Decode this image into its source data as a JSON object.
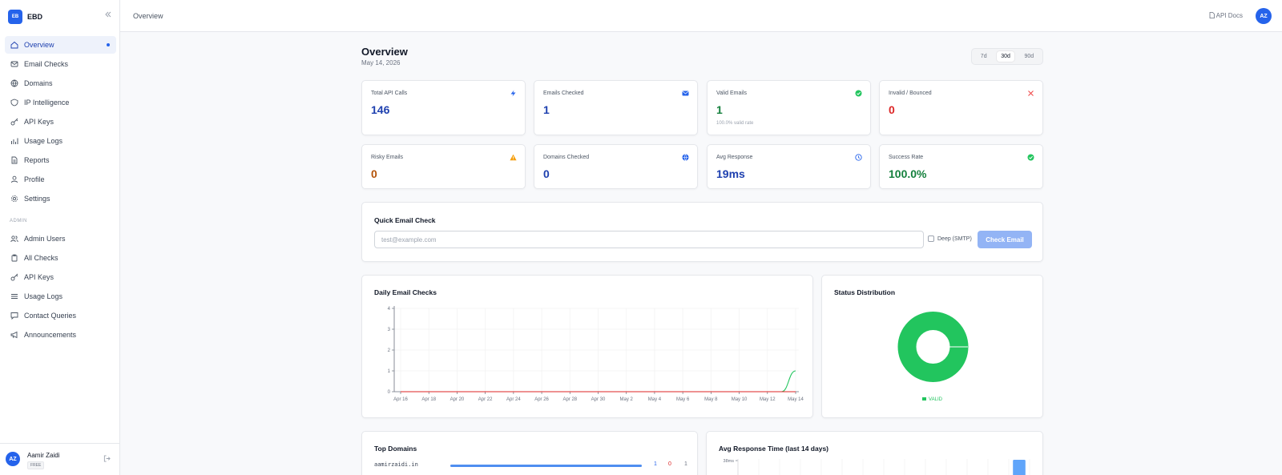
{
  "brand": {
    "logo": "EB",
    "name": "EBD"
  },
  "sidebar": {
    "items": [
      {
        "label": "Overview",
        "icon": "home-icon",
        "active": true
      },
      {
        "label": "Email Checks",
        "icon": "mail-icon"
      },
      {
        "label": "Domains",
        "icon": "globe-icon"
      },
      {
        "label": "IP Intelligence",
        "icon": "shield-icon"
      },
      {
        "label": "API Keys",
        "icon": "key-icon"
      },
      {
        "label": "Usage Logs",
        "icon": "bar-chart-icon"
      },
      {
        "label": "Reports",
        "icon": "file-icon"
      },
      {
        "label": "Profile",
        "icon": "user-icon"
      },
      {
        "label": "Settings",
        "icon": "gear-icon"
      }
    ],
    "admin_label": "ADMIN",
    "admin_items": [
      {
        "label": "Admin Users",
        "icon": "users-icon"
      },
      {
        "label": "All Checks",
        "icon": "clipboard-icon"
      },
      {
        "label": "API Keys",
        "icon": "key-icon"
      },
      {
        "label": "Usage Logs",
        "icon": "list-icon"
      },
      {
        "label": "Contact Queries",
        "icon": "message-icon"
      },
      {
        "label": "Announcements",
        "icon": "megaphone-icon"
      }
    ],
    "user": {
      "initials": "AZ",
      "name": "Aamir Zaidi",
      "plan": "FREE"
    }
  },
  "topbar": {
    "breadcrumb": "Overview",
    "api_docs": "API Docs",
    "avatar": "AZ"
  },
  "header": {
    "title": "Overview",
    "date": "May 14, 2026"
  },
  "range": {
    "options": [
      "7d",
      "30d",
      "90d"
    ],
    "selected": "30d"
  },
  "stats": [
    {
      "label": "Total API Calls",
      "value": "146",
      "color": "#1e40af",
      "icon": "bolt-icon"
    },
    {
      "label": "Emails Checked",
      "value": "1",
      "color": "#1e40af",
      "icon": "mail-icon"
    },
    {
      "label": "Valid Emails",
      "value": "1",
      "sub": "100.0% valid rate",
      "color": "#15803d",
      "icon": "check-circle-icon"
    },
    {
      "label": "Invalid / Bounced",
      "value": "0",
      "color": "#dc2626",
      "icon": "x-icon"
    },
    {
      "label": "Risky Emails",
      "value": "0",
      "color": "#b45309",
      "icon": "warning-icon"
    },
    {
      "label": "Domains Checked",
      "value": "0",
      "color": "#1e40af",
      "icon": "globe-icon"
    },
    {
      "label": "Avg Response",
      "value": "19ms",
      "color": "#1e40af",
      "icon": "clock-icon"
    },
    {
      "label": "Success Rate",
      "value": "100.0%",
      "color": "#15803d",
      "icon": "check-circle-icon"
    }
  ],
  "quick_check": {
    "title": "Quick Email Check",
    "placeholder": "test@example.com",
    "deep_label": "Deep (SMTP)",
    "button": "Check Email"
  },
  "daily_title": "Daily Email Checks",
  "status_title": "Status Distribution",
  "top_domains": {
    "title": "Top Domains",
    "rows": [
      {
        "domain": "aamirzaidi.in",
        "share": 1.0,
        "valid": "1",
        "invalid": "0",
        "total": "1"
      }
    ]
  },
  "avg_title": "Avg Response Time (last 14 days)",
  "colors": {
    "accent": "#2563eb",
    "valid": "#22c55e",
    "invalid": "#dc2626"
  },
  "chart_data": [
    {
      "type": "line",
      "title": "Daily Email Checks",
      "x": [
        "Apr 16",
        "Apr 17",
        "Apr 18",
        "Apr 19",
        "Apr 20",
        "Apr 21",
        "Apr 22",
        "Apr 23",
        "Apr 24",
        "Apr 25",
        "Apr 26",
        "Apr 27",
        "Apr 28",
        "Apr 29",
        "Apr 30",
        "May 1",
        "May 2",
        "May 3",
        "May 4",
        "May 5",
        "May 6",
        "May 7",
        "May 8",
        "May 9",
        "May 10",
        "May 11",
        "May 12",
        "May 13",
        "May 14"
      ],
      "xticks": [
        "Apr 16",
        "Apr 18",
        "Apr 20",
        "Apr 22",
        "Apr 24",
        "Apr 26",
        "Apr 28",
        "Apr 30",
        "May 2",
        "May 4",
        "May 6",
        "May 8",
        "May 10",
        "May 12",
        "May 14"
      ],
      "series": [
        {
          "values": [
            0,
            0,
            0,
            0,
            0,
            0,
            0,
            0,
            0,
            0,
            0,
            0,
            0,
            0,
            0,
            0,
            0,
            0,
            0,
            0,
            0,
            0,
            0,
            0,
            0,
            0,
            0,
            0,
            1
          ],
          "color": "#22c55e"
        },
        {
          "values": [
            0,
            0,
            0,
            0,
            0,
            0,
            0,
            0,
            0,
            0,
            0,
            0,
            0,
            0,
            0,
            0,
            0,
            0,
            0,
            0,
            0,
            0,
            0,
            0,
            0,
            0,
            0,
            0,
            0
          ],
          "color": "#dc2626"
        }
      ],
      "ylim": [
        0,
        4
      ],
      "yticks": [
        0,
        1,
        2,
        3,
        4
      ],
      "grid": true
    },
    {
      "type": "pie",
      "title": "Status Distribution",
      "categories": [
        "VALID"
      ],
      "values": [
        1
      ],
      "colors": [
        "#22c55e"
      ],
      "donut": true,
      "legend": "bottom"
    },
    {
      "type": "bar",
      "title": "Avg Response Time (last 14 days)",
      "yticks_label": "38ms",
      "values": [
        0,
        0,
        0,
        0,
        0,
        0,
        0,
        0,
        0,
        0,
        0,
        0,
        0,
        38
      ],
      "color": "#60a5fa"
    }
  ]
}
